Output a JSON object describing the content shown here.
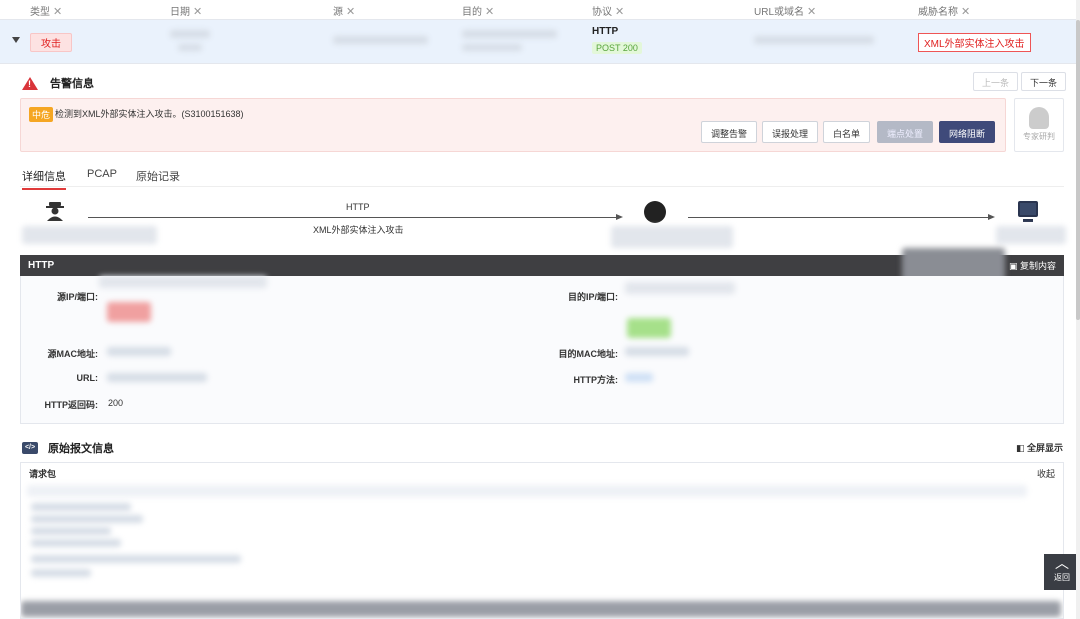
{
  "table": {
    "headers": [
      "类型",
      "日期",
      "源",
      "目的",
      "协议",
      "URL或域名",
      "威胁名称"
    ],
    "close_glyph": "✕",
    "row": {
      "type": "攻击",
      "protocol": "HTTP",
      "method_status": "POST   200",
      "threat": "XML外部实体注入攻击"
    }
  },
  "alert": {
    "section_title": "告警信息",
    "prev_label": "上一条",
    "next_label": "下一条",
    "level": "中危",
    "message": "检测到XML外部实体注入攻击。(S3100151638)",
    "buttons": [
      "调整告警",
      "误报处理",
      "白名单",
      "端点处置",
      "网络阻断"
    ],
    "expert_label": "专家研判"
  },
  "tabs": [
    "详细信息",
    "PCAP",
    "原始记录"
  ],
  "flow": {
    "protocol": "HTTP",
    "attack": "XML外部实体注入攻击"
  },
  "http_panel": {
    "title": "HTTP",
    "copy_label": "复制内容",
    "fields": {
      "src_ip": "源IP/端口:",
      "dst_ip": "目的IP/端口:",
      "src_mac": "源MAC地址:",
      "dst_mac": "目的MAC地址:",
      "url": "URL:",
      "http_method": "HTTP方法:",
      "http_code": "HTTP返回码:",
      "http_code_value": "200"
    }
  },
  "raw": {
    "section_title": "原始报文信息",
    "fullscreen_label": "全屏显示",
    "request_header": "请求包",
    "collapse_label": "收起"
  },
  "back_label": "返回",
  "icons": [
    "warning-icon",
    "hacker-icon",
    "globe-icon",
    "monitor-icon",
    "copy-icon",
    "code-icon",
    "fullscreen-icon",
    "chevron-up-icon",
    "caret-down-icon"
  ]
}
